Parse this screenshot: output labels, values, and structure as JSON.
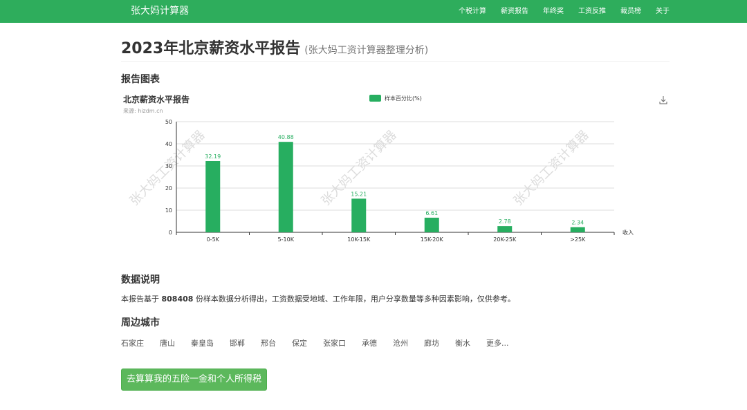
{
  "header": {
    "brand": "张大妈计算器",
    "nav": [
      "个税计算",
      "薪资报告",
      "年终奖",
      "工资反推",
      "裁员榜",
      "关于"
    ]
  },
  "page": {
    "title": "2023年北京薪资水平报告",
    "subtitle": "(张大妈工资计算器整理分析)"
  },
  "sections": {
    "chart": "报告图表",
    "data": "数据说明",
    "nearby": "周边城市"
  },
  "description": {
    "prefix": "本报告基于",
    "count": "808408",
    "suffix": "份样本数据分析得出，工资数据受地域、工作年限，用户分享数量等多种因素影响，仅供参考。"
  },
  "cities": [
    "石家庄",
    "唐山",
    "秦皇岛",
    "邯郸",
    "邢台",
    "保定",
    "张家口",
    "承德",
    "沧州",
    "廊坊",
    "衡水",
    "更多..."
  ],
  "cta_label": "去算算我的五险一金和个人所得税",
  "colors": {
    "brand": "#2ead5c",
    "bar": "#27ae60",
    "button": "#5cb85c"
  },
  "icons": {
    "download": "download-icon"
  },
  "chart_data": {
    "type": "bar",
    "title": "北京薪资水平报告",
    "subtitle": "来源: hizdm.cn",
    "watermark": "张大妈工资计算器",
    "categories": [
      "0-5K",
      "5-10K",
      "10K-15K",
      "15K-20K",
      "20K-25K",
      ">25K"
    ],
    "series": [
      {
        "name": "样本百分比(%)",
        "values": [
          32.19,
          40.88,
          15.21,
          6.61,
          2.78,
          2.34
        ]
      }
    ],
    "xlabel": "收入",
    "ylabel": "",
    "ylim": [
      0,
      50
    ],
    "yticks": [
      0,
      10,
      20,
      30,
      40,
      50
    ],
    "grid": true,
    "legend": "top-center"
  }
}
